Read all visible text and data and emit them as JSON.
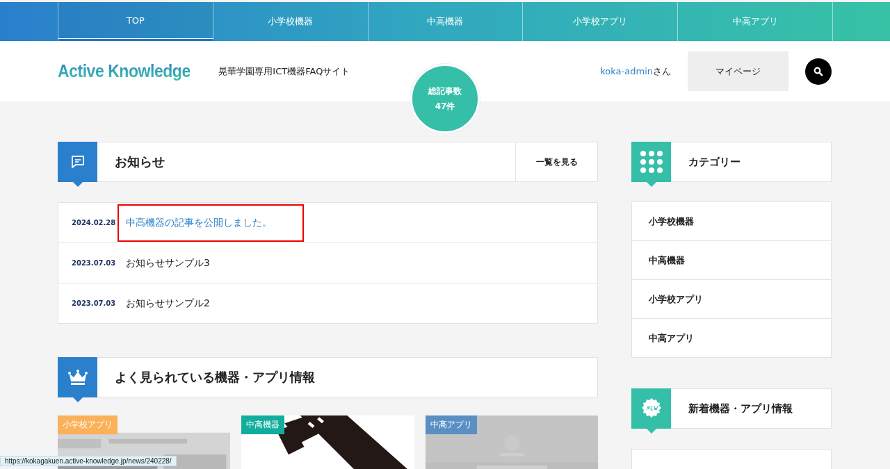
{
  "nav": [
    {
      "label": "TOP",
      "selected": true
    },
    {
      "label": "小学校機器",
      "selected": false
    },
    {
      "label": "中高機器",
      "selected": false
    },
    {
      "label": "小学校アプリ",
      "selected": false
    },
    {
      "label": "中高アプリ",
      "selected": false
    }
  ],
  "header": {
    "logo": "Active Knowledge",
    "tagline": "晃華学園専用ICT機器FAQサイト",
    "user_link": "koka-admin",
    "user_suffix": "さん",
    "mypage_button": "マイページ"
  },
  "counter": {
    "label": "総記事数",
    "value": "47件"
  },
  "news": {
    "title": "お知らせ",
    "more_button": "一覧を見る",
    "items": [
      {
        "date": "2024.02.28",
        "title": "中高機器の記事を公開しました。",
        "highlighted": true
      },
      {
        "date": "2023.07.03",
        "title": "お知らせサンプル3",
        "highlighted": false
      },
      {
        "date": "2023.07.03",
        "title": "お知らせサンプル2",
        "highlighted": false
      }
    ]
  },
  "popular": {
    "title": "よく見られている機器・アプリ情報",
    "cards": [
      {
        "tag": "小学校アプリ",
        "color": "#fbb05a",
        "kind": "picture"
      },
      {
        "tag": "中高機器",
        "color": "#12ad9c",
        "kind": "picture"
      },
      {
        "tag": "中高アプリ",
        "color": "#5a8fc4",
        "kind": "picture"
      }
    ]
  },
  "sidebar": {
    "category_title": "カテゴリー",
    "categories": [
      "小学校機器",
      "中高機器",
      "小学校アプリ",
      "中高アプリ"
    ],
    "new_title": "新着機器・アプリ情報"
  },
  "status_bar": "https://kokagakuen.active-knowledge.jp/news/240228/"
}
